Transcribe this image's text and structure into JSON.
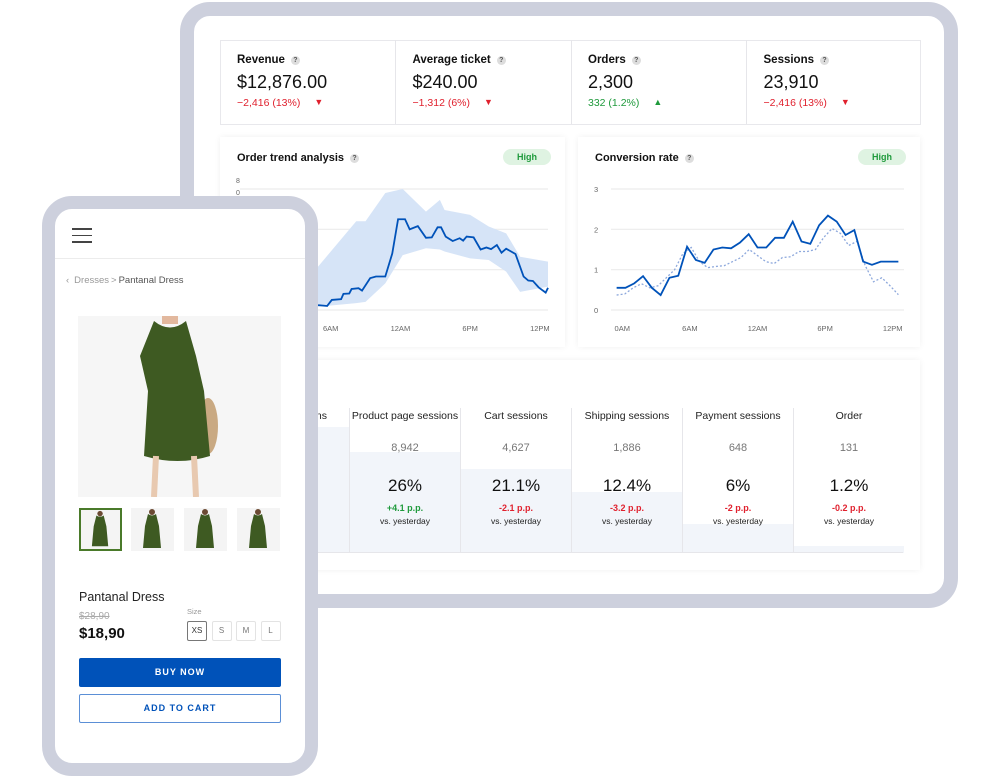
{
  "kpis": [
    {
      "label": "Revenue",
      "value": "$12,876.00",
      "change": "−2,416 (13%)",
      "direction": "down"
    },
    {
      "label": "Average ticket",
      "value": "$240.00",
      "change": "−1,312 (6%)",
      "direction": "down"
    },
    {
      "label": "Orders",
      "value": "2,300",
      "change": "332 (1.2%)",
      "direction": "up"
    },
    {
      "label": "Sessions",
      "value": "23,910",
      "change": "−2,416 (13%)",
      "direction": "down"
    }
  ],
  "help_icon": "?",
  "colors": {
    "accent": "#0052b9",
    "band": "#d6e4f7",
    "down": "#e0212e",
    "up": "#1f9a3c",
    "frame": "#cdd0dd"
  },
  "chart_data": [
    {
      "type": "line",
      "title": "Order trend analysis",
      "badge": "High",
      "x_ticks": [
        {
          "x": 6,
          "label": "6AM"
        },
        {
          "x": 12,
          "label": "12AM"
        },
        {
          "x": 18,
          "label": "6PM"
        },
        {
          "x": 24,
          "label": "12PM"
        }
      ],
      "y_ticks_visible": [
        "8",
        "0"
      ],
      "ylim": [
        0,
        3
      ],
      "xlim": [
        -1.8,
        24.7
      ],
      "grid": true,
      "line": {
        "x": [
          -1.8,
          2,
          4,
          4.9,
          5.7,
          6.1,
          6.9,
          7.1,
          7.6,
          7.8,
          8.4,
          8.7,
          9.4,
          9.9,
          10.7,
          11.3,
          11.8,
          12.4,
          12.8,
          13.5,
          14.2,
          14.7,
          15.2,
          15.5,
          15.9,
          16.5,
          17.1,
          17.4,
          17.7,
          18.3,
          18.9,
          19.4,
          19.8,
          20.3,
          20.7,
          21.1,
          21.9,
          22.6,
          23.0,
          23.4,
          23.9,
          24.5,
          24.7
        ],
        "y": [
          0.3,
          0.2,
          0.15,
          0.12,
          0.1,
          0.25,
          0.27,
          0.4,
          0.41,
          0.52,
          0.54,
          0.48,
          0.79,
          0.83,
          0.83,
          1.4,
          2.25,
          2.25,
          2.0,
          2.08,
          1.79,
          1.8,
          2.05,
          2.05,
          1.82,
          1.71,
          1.78,
          1.72,
          1.82,
          1.8,
          1.5,
          1.55,
          1.51,
          1.61,
          1.42,
          1.52,
          1.39,
          0.83,
          0.73,
          0.72,
          0.56,
          0.43,
          0.55
        ]
      },
      "band": {
        "x": [
          -1.8,
          2,
          4.9,
          8.2,
          9.0,
          10.7,
          12.2,
          14.2,
          15.4,
          15.8,
          18.0,
          19.6,
          21.1,
          22.3,
          24.7
        ],
        "upper": [
          0.9,
          1.0,
          1.07,
          2.2,
          2.2,
          2.9,
          3.0,
          2.44,
          2.73,
          2.48,
          2.36,
          2.07,
          1.9,
          1.32,
          1.2
        ],
        "lower": [
          0.1,
          0.08,
          0.08,
          0.17,
          0.2,
          0.66,
          1.36,
          1.53,
          1.5,
          1.45,
          1.28,
          1.24,
          0.95,
          0.45,
          0.58
        ]
      }
    },
    {
      "type": "line",
      "title": "Conversion rate",
      "badge": "High",
      "x_ticks": [
        {
          "x": 0,
          "label": "0AM"
        },
        {
          "x": 6,
          "label": "6AM"
        },
        {
          "x": 12,
          "label": "12AM"
        },
        {
          "x": 18,
          "label": "6PM"
        },
        {
          "x": 24,
          "label": "12PM"
        }
      ],
      "y_ticks": [
        0,
        1,
        2,
        3
      ],
      "ylim": [
        0,
        3
      ],
      "xlim": [
        -1,
        25
      ],
      "grid": true,
      "series": [
        {
          "style": "solid",
          "values": [
            0.55,
            0.55,
            0.66,
            0.84,
            0.55,
            0.37,
            0.8,
            0.85,
            1.57,
            1.24,
            1.17,
            1.5,
            1.55,
            1.53,
            1.67,
            1.88,
            1.55,
            1.55,
            1.79,
            1.79,
            2.19,
            1.7,
            1.64,
            2.1,
            2.34,
            2.19,
            1.86,
            1.98,
            1.2,
            1.12,
            1.2,
            1.2,
            1.2
          ]
        },
        {
          "style": "dotted",
          "values": [
            0.37,
            0.4,
            0.55,
            0.65,
            0.55,
            0.6,
            0.8,
            1.0,
            1.4,
            1.55,
            1.2,
            1.05,
            1.08,
            1.1,
            1.2,
            1.3,
            1.5,
            1.35,
            1.2,
            1.15,
            1.3,
            1.32,
            1.45,
            1.45,
            1.5,
            1.8,
            2.02,
            1.9,
            1.6,
            1.7,
            1.1,
            0.7,
            0.8,
            0.6,
            0.38
          ]
        }
      ]
    }
  ],
  "funnel": [
    {
      "label": "ns",
      "count": "",
      "pct": "",
      "pp": "",
      "vs": "",
      "level": 0.87
    },
    {
      "label": "Product page sessions",
      "count": "8,942",
      "pct": "26%",
      "pp": "+4.1 p.p.",
      "dir": "up",
      "vs": "vs. yesterday",
      "level": 0.7
    },
    {
      "label": "Cart sessions",
      "count": "4,627",
      "pct": "21.1%",
      "pp": "-2.1 p.p.",
      "dir": "down",
      "vs": "vs. yesterday",
      "level": 0.58
    },
    {
      "label": "Shipping sessions",
      "count": "1,886",
      "pct": "12.4%",
      "pp": "-3.2 p.p.",
      "dir": "down",
      "vs": "vs. yesterday",
      "level": 0.42
    },
    {
      "label": "Payment sessions",
      "count": "648",
      "pct": "6%",
      "pp": "-2 p.p.",
      "dir": "down",
      "vs": "vs. yesterday",
      "level": 0.2
    },
    {
      "label": "Order",
      "count": "131",
      "pct": "1.2%",
      "pp": "-0.2 p.p.",
      "dir": "down",
      "vs": "vs. yesterday",
      "level": 0.05
    }
  ],
  "phone": {
    "breadcrumb": {
      "back": "‹",
      "parent": "Dresses",
      "sep": ">",
      "current": "Pantanal Dress"
    },
    "product": {
      "title": "Pantanal Dress",
      "old_price": "$28,90",
      "price": "$18,90",
      "size_label": "Size",
      "sizes": [
        "XS",
        "S",
        "M",
        "L"
      ],
      "selected_size": "XS"
    },
    "buy_now": "BUY NOW",
    "add_to_cart": "ADD TO CART"
  }
}
